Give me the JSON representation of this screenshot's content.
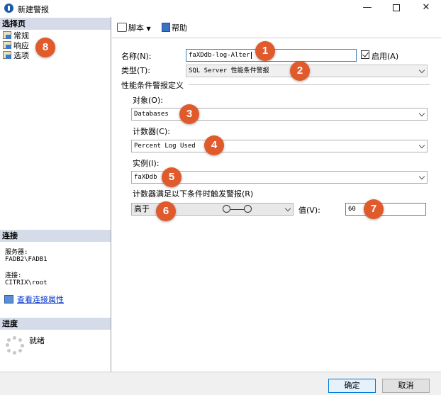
{
  "window": {
    "title": "新建警报"
  },
  "left": {
    "select_page_header": "选择页",
    "pages": [
      "常规",
      "响应",
      "选项"
    ],
    "connection_header": "连接",
    "server_label": "服务器:",
    "server_value": "FADB2\\FADB1",
    "conn_label": "连接:",
    "conn_value": "CITRIX\\root",
    "view_conn_link": "查看连接属性",
    "progress_header": "进度",
    "progress_status": "就绪"
  },
  "toolbar": {
    "script_label": "脚本",
    "help_label": "帮助"
  },
  "form": {
    "name_label": "名称(N):",
    "name_value": "faXDdb-log-Alter",
    "enable_label": "启用(A)",
    "type_label": "类型(T):",
    "type_value": "SQL Server 性能条件警报",
    "definition_header": "性能条件警报定义",
    "object_label": "对象(O):",
    "object_value": "Databases",
    "counter_label": "计数器(C):",
    "counter_value": "Percent Log Used",
    "instance_label": "实例(I):",
    "instance_value": "faXDdb",
    "condition_label": "计数器满足以下条件时触发警报(R)",
    "condition_value": "高于",
    "value_label": "值(V):",
    "value_value": "60"
  },
  "badges": [
    "1",
    "2",
    "3",
    "4",
    "5",
    "6",
    "7",
    "8"
  ],
  "footer": {
    "ok_label": "确定",
    "cancel_label": "取消"
  },
  "colors": {
    "badge": "#e05a2b",
    "section_header": "#d6dbe9",
    "link": "#0033cc",
    "primary_border": "#0078d7"
  }
}
